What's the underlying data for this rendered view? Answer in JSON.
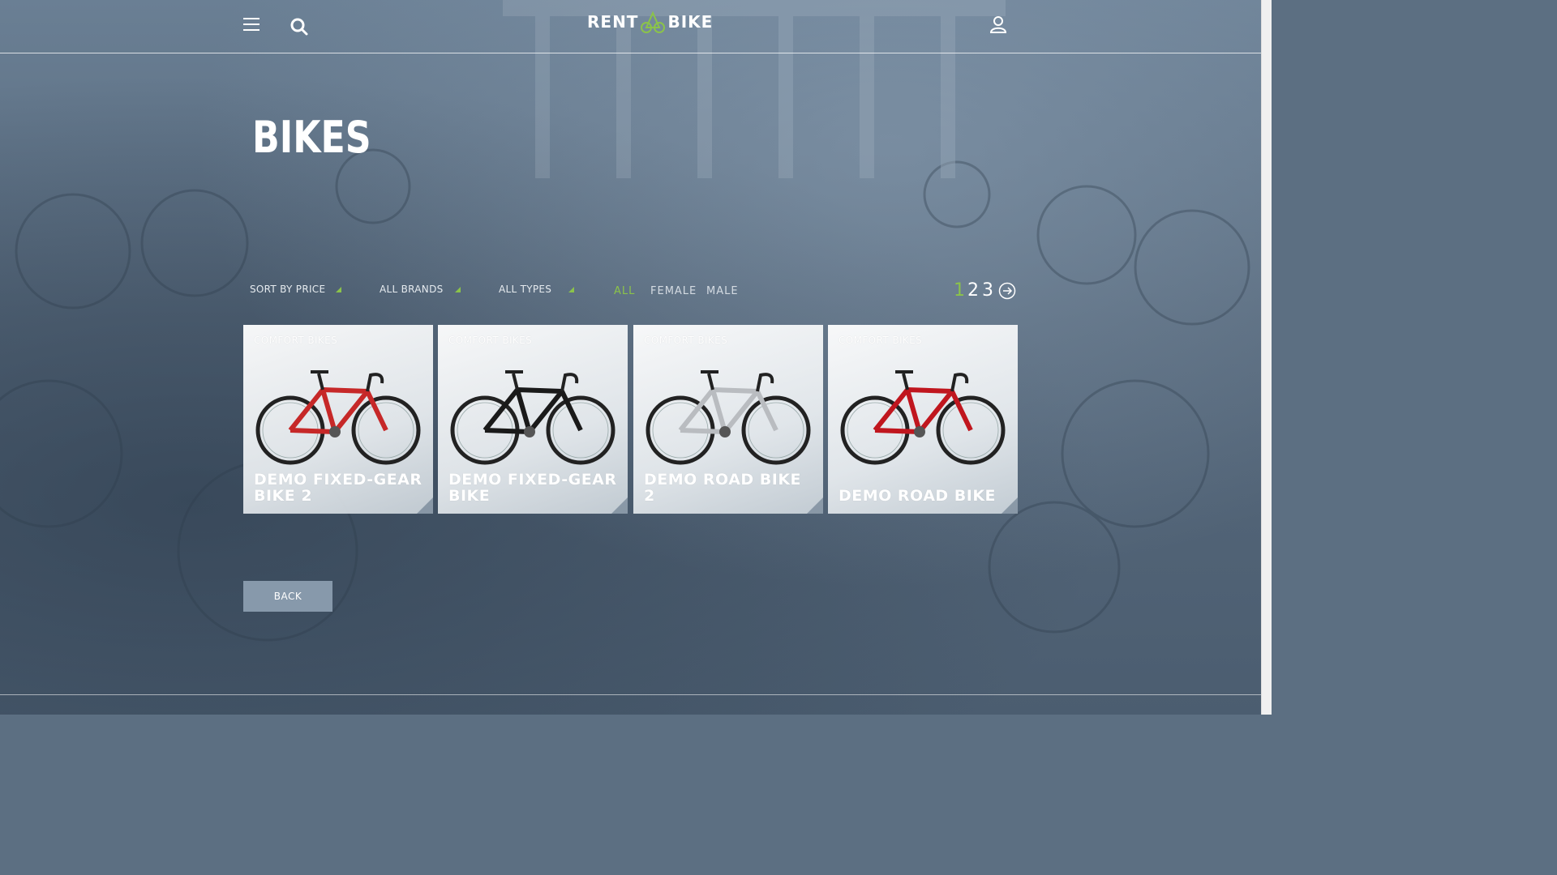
{
  "header": {
    "logo_left": "RENT",
    "logo_right": "BIKE"
  },
  "page": {
    "title": "BIKES"
  },
  "filters": {
    "sort": "SORT BY PRICE",
    "brands": "ALL BRANDS",
    "types": "ALL TYPES",
    "gender": [
      "ALL",
      "FEMALE",
      "MALE"
    ],
    "active_gender": "ALL"
  },
  "pagination": {
    "pages": [
      "1",
      "2",
      "3"
    ],
    "current": "1"
  },
  "cards": [
    {
      "category": "COMFORT BIKES",
      "name": "DEMO FIXED-GEAR BIKE 2",
      "frame_color": "#c62828"
    },
    {
      "category": "COMFORT BIKES",
      "name": "DEMO FIXED-GEAR BIKE",
      "frame_color": "#1a1a1a"
    },
    {
      "category": "COMFORT BIKES",
      "name": "DEMO ROAD BIKE 2",
      "frame_color": "#b9bcc0"
    },
    {
      "category": "COMFORT BIKES",
      "name": "DEMO ROAD BIKE",
      "frame_color": "#c0161e"
    }
  ],
  "back_label": "BACK",
  "colors": {
    "accent": "#8bc34a",
    "background": "#5c6f82",
    "button": "#8799ab"
  }
}
